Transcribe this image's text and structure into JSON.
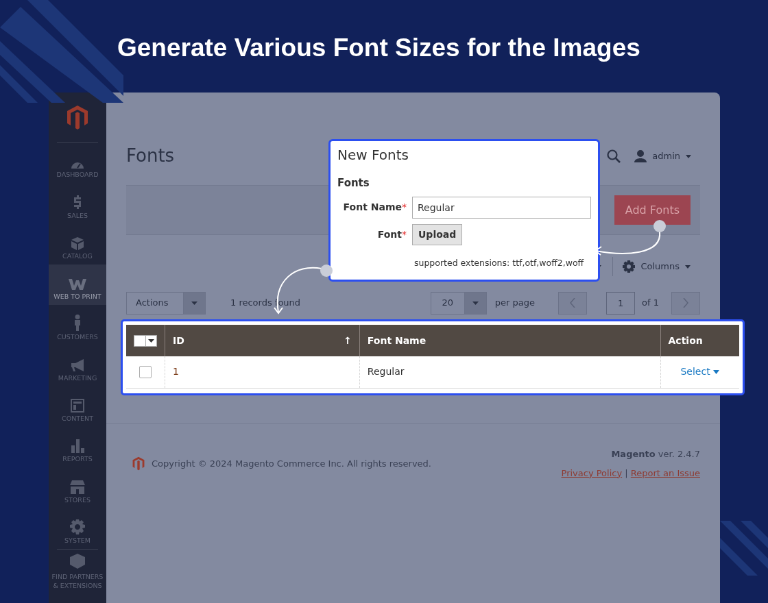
{
  "headline": "Generate Various Font Sizes for the Images",
  "sidebar": {
    "items": [
      {
        "label": "DASHBOARD",
        "selected": false
      },
      {
        "label": "SALES",
        "selected": false
      },
      {
        "label": "CATALOG",
        "selected": false
      },
      {
        "label": "WEB TO PRINT",
        "selected": true
      },
      {
        "label": "CUSTOMERS",
        "selected": false
      },
      {
        "label": "MARKETING",
        "selected": false
      },
      {
        "label": "CONTENT",
        "selected": false
      },
      {
        "label": "REPORTS",
        "selected": false
      },
      {
        "label": "STORES",
        "selected": false
      },
      {
        "label": "SYSTEM",
        "selected": false
      }
    ],
    "extra_item": "FIND PARTNERS & EXTENSIONS"
  },
  "header": {
    "page_title": "Fonts",
    "user": "admin"
  },
  "toolbar": {
    "add_button": "Add Fonts",
    "columns_button": "Columns"
  },
  "grid_controls": {
    "actions": "Actions",
    "records": "1 records found",
    "per_page_value": "20",
    "per_page_label": "per page",
    "page": "1",
    "page_total": "of 1"
  },
  "table": {
    "mass_select": {
      "checked": false
    },
    "columns": [
      "ID",
      "Font Name",
      "Action"
    ],
    "sort_mark": "↑",
    "rows": [
      {
        "id": "1",
        "font_name": "Regular",
        "action": "Select",
        "checked": false
      }
    ]
  },
  "dialog": {
    "title": "New Fonts",
    "section": "Fonts",
    "fields": [
      {
        "kind": "text",
        "label": "Font Name",
        "required_mark": "*",
        "value": "Regular"
      },
      {
        "kind": "upload",
        "label": "Font",
        "required_mark": "*",
        "button": "Upload",
        "note": "supported extensions: ttf,otf,woff2,woff"
      }
    ]
  },
  "footer": {
    "copyright": "Copyright © 2024 Magento Commerce Inc. All rights reserved.",
    "brand": "Magento",
    "version": "ver. 2.4.7",
    "links": [
      "Privacy Policy",
      "Report an Issue"
    ],
    "separator": "|"
  }
}
